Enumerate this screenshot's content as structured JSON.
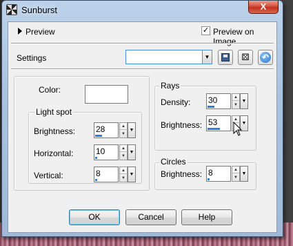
{
  "window": {
    "title": "Sunburst",
    "close_label": "X"
  },
  "preview": {
    "label": "Preview",
    "preview_on_image_label": "Preview on Image",
    "preview_on_image_checked": true,
    "check_mark": "✓"
  },
  "settings": {
    "label": "Settings",
    "value": "",
    "dropdown_arrow": "▼"
  },
  "toolbar": {
    "save_icon": "save-icon",
    "randomize_icon": "dice-icon",
    "reset_icon": "reset-icon",
    "randomize_glyph": "⚄",
    "reset_glyph": "↶"
  },
  "color": {
    "label": "Color:",
    "value_hex": "#ffffff"
  },
  "light_spot": {
    "title": "Light spot",
    "brightness_label": "Brightness:",
    "brightness_value": "28",
    "brightness_fraction": 0.28,
    "horizontal_label": "Horizontal:",
    "horizontal_value": "10",
    "horizontal_fraction": 0.1,
    "vertical_label": "Vertical:",
    "vertical_value": "8",
    "vertical_fraction": 0.08
  },
  "rays": {
    "title": "Rays",
    "density_label": "Density:",
    "density_value": "30",
    "density_fraction": 0.3,
    "brightness_label": "Brightness:",
    "brightness_value": "53",
    "brightness_fraction": 0.53
  },
  "circles": {
    "title": "Circles",
    "brightness_label": "Brightness:",
    "brightness_value": "8",
    "brightness_fraction": 0.08
  },
  "spin_glyphs": {
    "up": "▲",
    "down": "▼",
    "dropdown": "▼"
  },
  "buttons": {
    "ok": "OK",
    "cancel": "Cancel",
    "help": "Help"
  },
  "colors": {
    "accent_bar": "#2a7ee0",
    "close_button": "#c0321e"
  }
}
